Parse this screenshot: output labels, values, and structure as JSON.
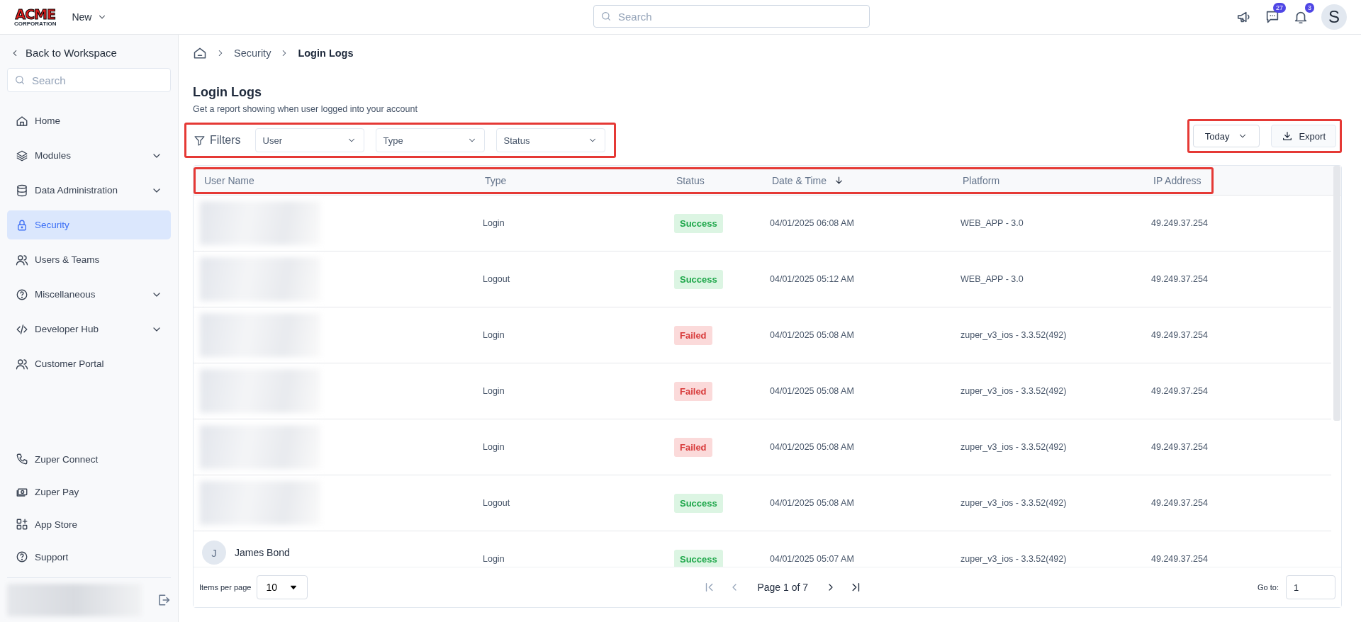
{
  "topbar": {
    "logo": {
      "top": "ACME",
      "bottom": "CORPORATION"
    },
    "new_menu": "New",
    "search": {
      "placeholder": "Search"
    },
    "chat_badge": "27",
    "bell_badge": "3",
    "avatar": "S"
  },
  "sidebar": {
    "back": "Back to Workspace",
    "search": {
      "placeholder": "Search"
    },
    "items": [
      {
        "label": "Home",
        "expandable": false,
        "selected": false
      },
      {
        "label": "Modules",
        "expandable": true,
        "selected": false
      },
      {
        "label": "Data Administration",
        "expandable": true,
        "selected": false
      },
      {
        "label": "Security",
        "expandable": false,
        "selected": true
      },
      {
        "label": "Users & Teams",
        "expandable": false,
        "selected": false
      },
      {
        "label": "Miscellaneous",
        "expandable": true,
        "selected": false
      },
      {
        "label": "Developer Hub",
        "expandable": true,
        "selected": false
      },
      {
        "label": "Customer Portal",
        "expandable": false,
        "selected": false
      }
    ],
    "bottom_items": [
      {
        "label": "Zuper Connect"
      },
      {
        "label": "Zuper Pay"
      },
      {
        "label": "App Store"
      },
      {
        "label": "Support"
      }
    ]
  },
  "breadcrumb": [
    "Security",
    "Login Logs"
  ],
  "page": {
    "title": "Login Logs",
    "subtitle": "Get a report showing when user logged into your account"
  },
  "filters": {
    "label": "Filters",
    "dropdowns": [
      "User",
      "Type",
      "Status"
    ]
  },
  "date_range": "Today",
  "export": "Export",
  "table": {
    "columns": [
      {
        "label": "User Name",
        "sorted": false
      },
      {
        "label": "Type",
        "sorted": false
      },
      {
        "label": "Status",
        "sorted": false
      },
      {
        "label": "Date & Time",
        "sorted": true
      },
      {
        "label": "Platform",
        "sorted": false
      },
      {
        "label": "IP Address",
        "sorted": false
      }
    ],
    "rows": [
      {
        "kind": "redacted",
        "type": "Login",
        "status": {
          "label": "Success",
          "kind": "success"
        },
        "datetime": "04/01/2025 06:08 AM",
        "platform": "WEB_APP - 3.0",
        "ip": "49.249.37.254"
      },
      {
        "kind": "redacted",
        "type": "Logout",
        "status": {
          "label": "Success",
          "kind": "success"
        },
        "datetime": "04/01/2025 05:12 AM",
        "platform": "WEB_APP - 3.0",
        "ip": "49.249.37.254"
      },
      {
        "kind": "redacted",
        "type": "Login",
        "status": {
          "label": "Failed",
          "kind": "failed"
        },
        "datetime": "04/01/2025 05:08 AM",
        "platform": "zuper_v3_ios - 3.3.52(492)",
        "ip": "49.249.37.254"
      },
      {
        "kind": "redacted",
        "type": "Login",
        "status": {
          "label": "Failed",
          "kind": "failed"
        },
        "datetime": "04/01/2025 05:08 AM",
        "platform": "zuper_v3_ios - 3.3.52(492)",
        "ip": "49.249.37.254"
      },
      {
        "kind": "redacted",
        "type": "Login",
        "status": {
          "label": "Failed",
          "kind": "failed"
        },
        "datetime": "04/01/2025 05:08 AM",
        "platform": "zuper_v3_ios - 3.3.52(492)",
        "ip": "49.249.37.254"
      },
      {
        "kind": "redacted",
        "type": "Logout",
        "status": {
          "label": "Success",
          "kind": "success"
        },
        "datetime": "04/01/2025 05:08 AM",
        "platform": "zuper_v3_ios - 3.3.52(492)",
        "ip": "49.249.37.254"
      },
      {
        "kind": "named",
        "avatar": "J",
        "user_name": "James Bond",
        "type": "Login",
        "status": {
          "label": "Success",
          "kind": "success"
        },
        "datetime": "04/01/2025 05:07 AM",
        "platform": "zuper_v3_ios - 3.3.52(492)",
        "ip": "49.249.37.254"
      }
    ]
  },
  "pagination": {
    "items_per_page_label": "Items per page",
    "items_per_page": "10",
    "page": "Page 1 of 7",
    "goto_label": "Go to:",
    "goto_value": "1"
  }
}
